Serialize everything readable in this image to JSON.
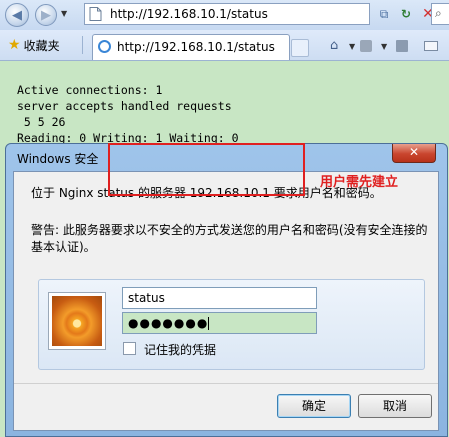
{
  "browser": {
    "address": "http://192.168.10.1/status",
    "favorites_label": "收藏夹",
    "tab_title": "http://192.168.10.1/status"
  },
  "page": {
    "status_lines": "Active connections: 1\nserver accepts handled requests\n 5 5 26\nReading: 0 Writing: 1 Waiting: 0"
  },
  "dialog": {
    "title": "Windows 安全",
    "close_label": "✕",
    "message": "位于 Nginx status 的服务器 192.168.10.1 要求用户名和密码。",
    "warning": "警告: 此服务器要求以不安全的方式发送您的用户名和密码(没有安全连接的基本认证)。",
    "username_value": "status",
    "password_mask": "●●●●●●●",
    "remember_label": "记住我的凭据",
    "ok_label": "确定",
    "cancel_label": "取消",
    "annotation": "用户需先建立"
  },
  "colors": {
    "page_background": "#c8e6c4",
    "annotation_red": "#e02020"
  }
}
